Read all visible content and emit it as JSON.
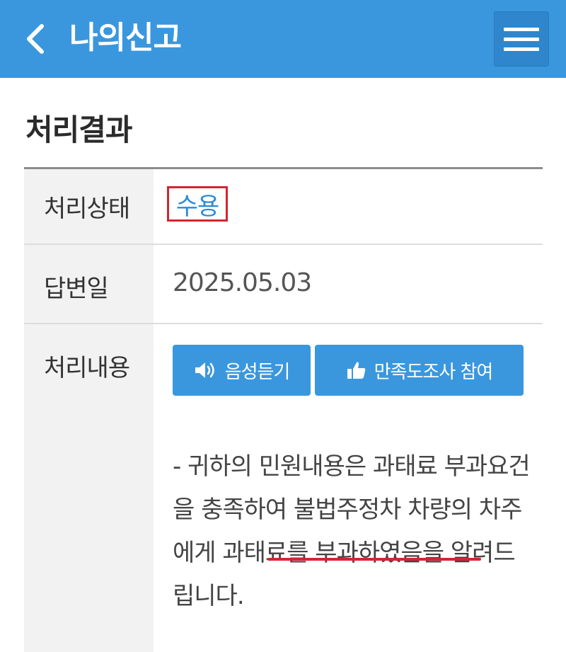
{
  "header": {
    "title": "나의신고",
    "back_icon": "chevron-left-icon",
    "menu_icon": "hamburger-menu-icon",
    "background": "#3a97de"
  },
  "section": {
    "title": "처리결과"
  },
  "table": {
    "status_label": "처리상태",
    "status_value": "수용",
    "date_label": "답변일",
    "date_value": "2025.05.03",
    "content_label": "처리내용",
    "voice_button": "음성듣기",
    "voice_icon": "speaker-icon",
    "survey_button": "만족도조사 참여",
    "survey_icon": "thumbs-up-icon",
    "content_text": "- 귀하의 민원내용은 과태료 부과요건을 충족하여 불법주정차 차량의 차주에게 과태료를 부과하였음을 알려드립니다."
  },
  "colors": {
    "accent": "#3a97de",
    "highlight_red": "#d3262f",
    "status_blue": "#2b8ad6"
  }
}
